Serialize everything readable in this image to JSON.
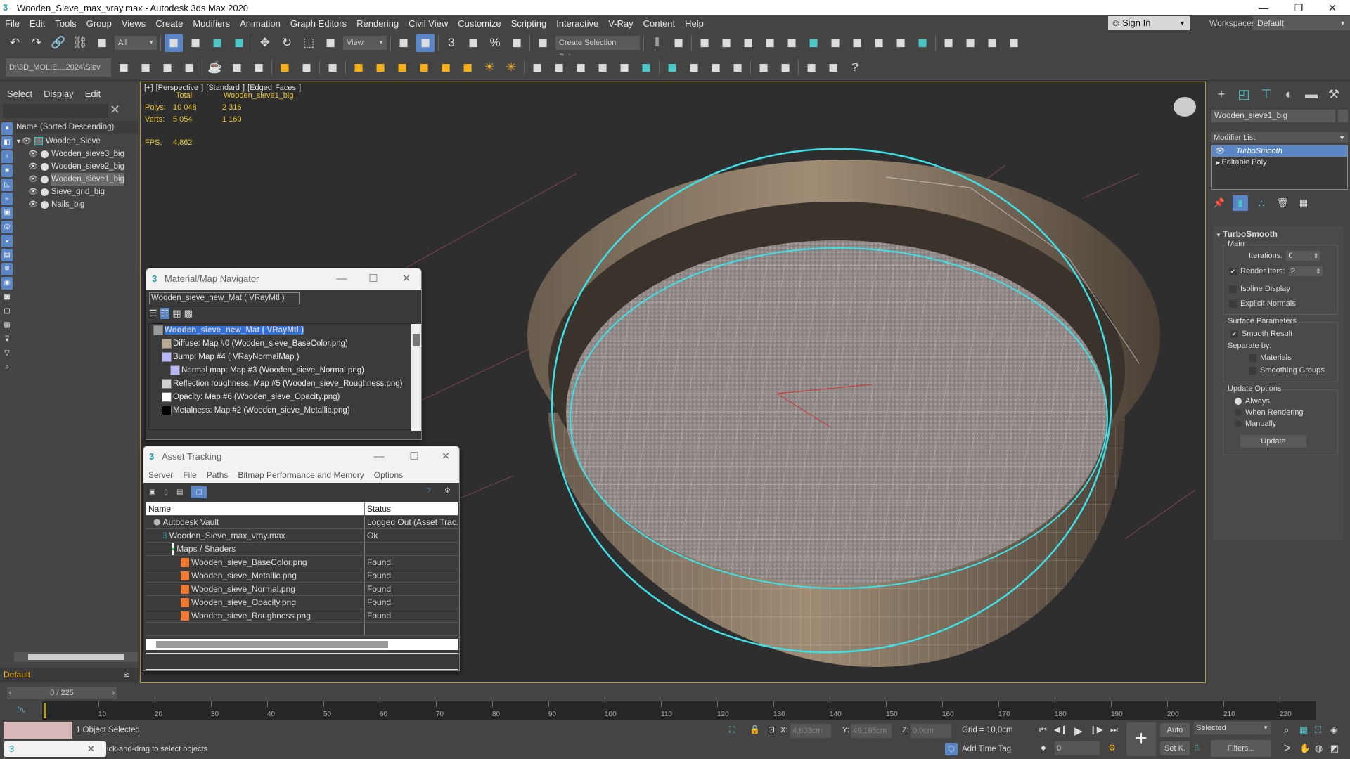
{
  "window": {
    "title": "Wooden_Sieve_max_vray.max - Autodesk 3ds Max 2020",
    "minimize": "—",
    "maximize": "❐",
    "close": "✕"
  },
  "menu": [
    "File",
    "Edit",
    "Tools",
    "Group",
    "Views",
    "Create",
    "Modifiers",
    "Animation",
    "Graph Editors",
    "Rendering",
    "Civil View",
    "Customize",
    "Scripting",
    "Interactive",
    "V-Ray",
    "Content",
    "Help"
  ],
  "account": {
    "sign_in": "Sign In",
    "workspaces_label": "Workspaces:",
    "workspace": "Default"
  },
  "toolbar1": {
    "selection_filter": "All",
    "ref_coord": "View",
    "selection_set": "Create Selection Set",
    "icons": [
      "undo-icon",
      "redo-icon",
      "link-icon",
      "unlink-icon",
      "bind-spacewarp-icon",
      "|",
      "select-object-icon",
      "select-by-name-icon",
      "rect-selection-icon",
      "window-crossing-icon",
      "|",
      "move-icon",
      "rotate-icon",
      "scale-icon",
      "placement-icon",
      "|",
      "pivot-icon",
      "keyboard-shortcut-icon",
      "|",
      "snap-3d-icon",
      "angle-snap-icon",
      "percent-snap-icon",
      "spinner-snap-icon",
      "|",
      "edit-named-sets-icon",
      "|",
      "mirror-icon",
      "align-icon",
      "|",
      "scene-explorer-icon",
      "layer-explorer-icon",
      "toggle-ribbon-icon",
      "curve-editor-icon",
      "schematic-view-icon",
      "material-editor-icon",
      "render-setup-icon",
      "rendered-frame-icon",
      "render-icon",
      "render-iterative-icon",
      "render-cloud-icon",
      "|",
      "vray-frame-buffer-icon",
      "vray-asset-editor-icon",
      "vray-render-icon",
      "vray-lister-icon"
    ]
  },
  "toolbar2": {
    "project_path": "D:\\3D_MOLIE....2024\\Siev",
    "icons": [
      "project-folder-icon",
      "new-project-icon",
      "set-project-icon",
      "project-files-icon",
      "|",
      "teapot-icon",
      "vray-sphere-icon",
      "vray-proxy-icon",
      "|",
      "vray-light-icon",
      "vray-camera-icon",
      "|",
      "physical-camera-icon",
      "|",
      "vray-plane-icon",
      "vray-dome-icon",
      "vray-sphere-light-icon",
      "vray-mesh-light-icon",
      "vray-ies-icon",
      "vray-ambient-icon",
      "vray-sun-icon",
      "vray-light-select-icon",
      "|",
      "vray-toon-icon",
      "vray-clipper-icon",
      "vray-obj-props-icon",
      "vray-decal-icon",
      "vray-fur-icon",
      "vray-volume-icon",
      "|",
      "vray-material-icon",
      "vray-multimat-icon",
      "vray-mtl-icon",
      "vray-convert-icon",
      "|",
      "vray-bake-icon",
      "vray-logo-icon",
      "|",
      "vray-tree-icon",
      "vray-settings-icon",
      "help-icon"
    ]
  },
  "scene_explorer": {
    "menu": [
      "Select",
      "Display",
      "Edit"
    ],
    "column_header": "Name (Sorted Descending)",
    "root": "Wooden_Sieve",
    "items": [
      {
        "name": "Wooden_sieve3_big",
        "selected": false
      },
      {
        "name": "Wooden_sieve2_big",
        "selected": false
      },
      {
        "name": "Wooden_sieve1_big",
        "selected": true
      },
      {
        "name": "Sieve_grid_big",
        "selected": false
      },
      {
        "name": "Nails_big",
        "selected": false
      }
    ],
    "layer": "Default"
  },
  "viewport": {
    "label": "[+] [Perspective ] [Standard ] [Edged Faces ]",
    "stats": {
      "col_total": "Total",
      "col_selected": "Wooden_sieve1_big",
      "polys_label": "Polys:",
      "polys_total": "10 048",
      "polys_selected": "2 316",
      "verts_label": "Verts:",
      "verts_total": "5 054",
      "verts_selected": "1 160",
      "fps_label": "FPS:",
      "fps": "4,862"
    },
    "colors": {
      "wire_selection": "#3ee0e8",
      "border": "#a89a40"
    }
  },
  "material_navigator": {
    "title": "Material/Map Navigator",
    "current": "Wooden_sieve_new_Mat  ( VRayMtl )",
    "tree": [
      {
        "label": "Wooden_sieve_new_Mat  ( VRayMtl )",
        "level": 0,
        "swatch": "#9a9a9a",
        "selected": true
      },
      {
        "label": "Diffuse: Map #0 (Wooden_sieve_BaseColor.png)",
        "level": 1,
        "swatch": "#b8a890"
      },
      {
        "label": "Bump: Map #4  ( VRayNormalMap )",
        "level": 1,
        "swatch": "#b8b8f8"
      },
      {
        "label": "Normal map: Map #3 (Wooden_sieve_Normal.png)",
        "level": 2,
        "swatch": "#b8b8f8"
      },
      {
        "label": "Reflection roughness: Map #5 (Wooden_sieve_Roughness.png)",
        "level": 1,
        "swatch": "#cfcfcf"
      },
      {
        "label": "Opacity: Map #6 (Wooden_sieve_Opacity.png)",
        "level": 1,
        "swatch": "#ffffff"
      },
      {
        "label": "Metalness: Map #2 (Wooden_sieve_Metallic.png)",
        "level": 1,
        "swatch": "#000000"
      }
    ]
  },
  "asset_tracking": {
    "title": "Asset Tracking",
    "menu": [
      "Server",
      "File",
      "Paths",
      "Bitmap Performance and Memory",
      "Options"
    ],
    "columns": [
      "Name",
      "Status"
    ],
    "rows": [
      {
        "name": "Autodesk Vault",
        "status": "Logged Out (Asset Trac...",
        "level": 0,
        "icon": "vault-icon"
      },
      {
        "name": "Wooden_Sieve_max_vray.max",
        "status": "Ok",
        "level": 1,
        "icon": "max-file-icon"
      },
      {
        "name": "Maps / Shaders",
        "status": "",
        "level": 2,
        "icon": "maps-folder-icon"
      },
      {
        "name": "Wooden_sieve_BaseColor.png",
        "status": "Found",
        "level": 3,
        "icon": "png-file-icon"
      },
      {
        "name": "Wooden_sieve_Metallic.png",
        "status": "Found",
        "level": 3,
        "icon": "png-file-icon"
      },
      {
        "name": "Wooden_sieve_Normal.png",
        "status": "Found",
        "level": 3,
        "icon": "png-file-icon"
      },
      {
        "name": "Wooden_sieve_Opacity.png",
        "status": "Found",
        "level": 3,
        "icon": "png-file-icon"
      },
      {
        "name": "Wooden_sieve_Roughness.png",
        "status": "Found",
        "level": 3,
        "icon": "png-file-icon"
      }
    ]
  },
  "command_panel": {
    "object_name": "Wooden_sieve1_big",
    "modifier_list": "Modifier List",
    "stack": [
      "TurboSmooth",
      "Editable Poly"
    ],
    "rollout_title": "TurboSmooth",
    "main_group": "Main",
    "iterations_label": "Iterations:",
    "iterations": "0",
    "render_iters_label": "Render Iters:",
    "render_iters": "2",
    "render_iters_checked": true,
    "isoline_label": "Isoline Display",
    "isoline_checked": false,
    "explicit_normals_label": "Explicit Normals",
    "explicit_normals_checked": false,
    "surface_group": "Surface Parameters",
    "smooth_result_label": "Smooth Result",
    "smooth_result_checked": true,
    "separate_by": "Separate by:",
    "materials_label": "Materials",
    "smoothing_groups_label": "Smoothing Groups",
    "update_group": "Update Options",
    "update_options": [
      "Always",
      "When Rendering",
      "Manually"
    ],
    "update_selected": "Always",
    "update_button": "Update"
  },
  "timeline": {
    "frame": "0 / 225",
    "ticks": [
      "10",
      "20",
      "30",
      "40",
      "50",
      "60",
      "70",
      "80",
      "90",
      "100",
      "110",
      "120",
      "130",
      "140",
      "150",
      "160",
      "170",
      "180",
      "190",
      "200",
      "210",
      "220"
    ]
  },
  "status": {
    "selection": "1 Object Selected",
    "prompt": "ick-and-drag to select objects",
    "x_label": "X:",
    "x": "4,803cm",
    "y_label": "Y:",
    "y": "49,165cm",
    "z_label": "Z:",
    "z": "0,0cm",
    "grid": "Grid = 10,0cm",
    "add_time_tag": "Add Time Tag",
    "current_frame": "0",
    "auto_key": "Auto",
    "set_key": "Set K.",
    "key_filter": "Selected",
    "filters": "Filters..."
  }
}
